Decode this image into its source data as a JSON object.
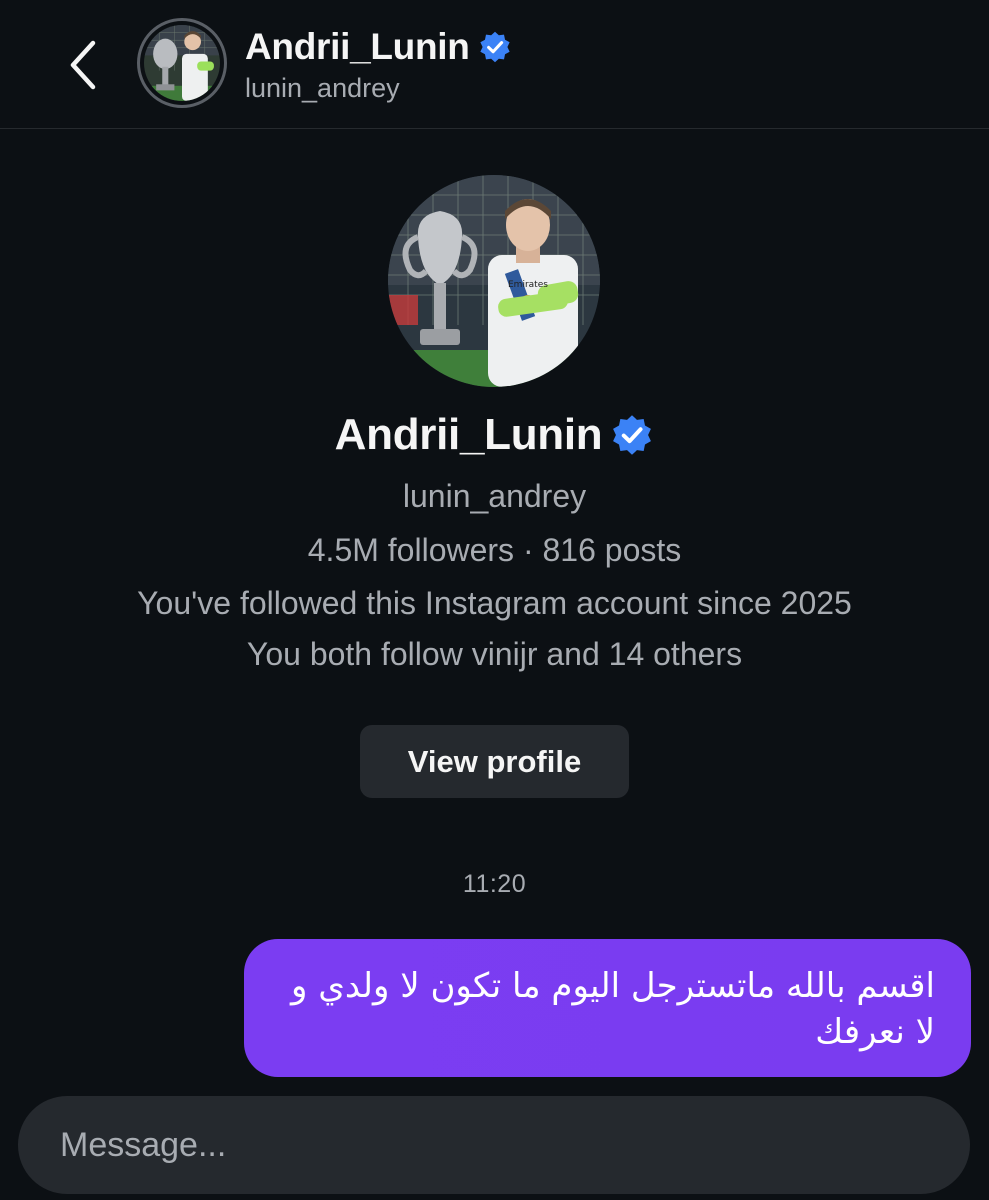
{
  "header": {
    "back_icon": "chevron-left-icon",
    "name": "Andrii_Lunin",
    "username": "lunin_andrey",
    "verified_icon": "verified-badge-icon"
  },
  "profile": {
    "name": "Andrii_Lunin",
    "username": "lunin_andrey",
    "stats": "4.5M followers · 816 posts",
    "followed_since": "You've followed this Instagram account since 2025",
    "mutuals": "You both follow vinijr and 14 others",
    "view_profile_label": "View profile"
  },
  "thread": {
    "timestamp": "11:20",
    "messages": [
      {
        "text": "اقسم بالله ماتسترجل اليوم ما تكون لا ولدي و لا نعرفك",
        "sender": "me"
      }
    ]
  },
  "composer": {
    "placeholder": "Message..."
  },
  "colors": {
    "background": "#0c1014",
    "bubble": "#7a3cf0",
    "verified": "#3b82f6",
    "button_bg": "#25292e",
    "secondary_text": "#a8acb2"
  }
}
